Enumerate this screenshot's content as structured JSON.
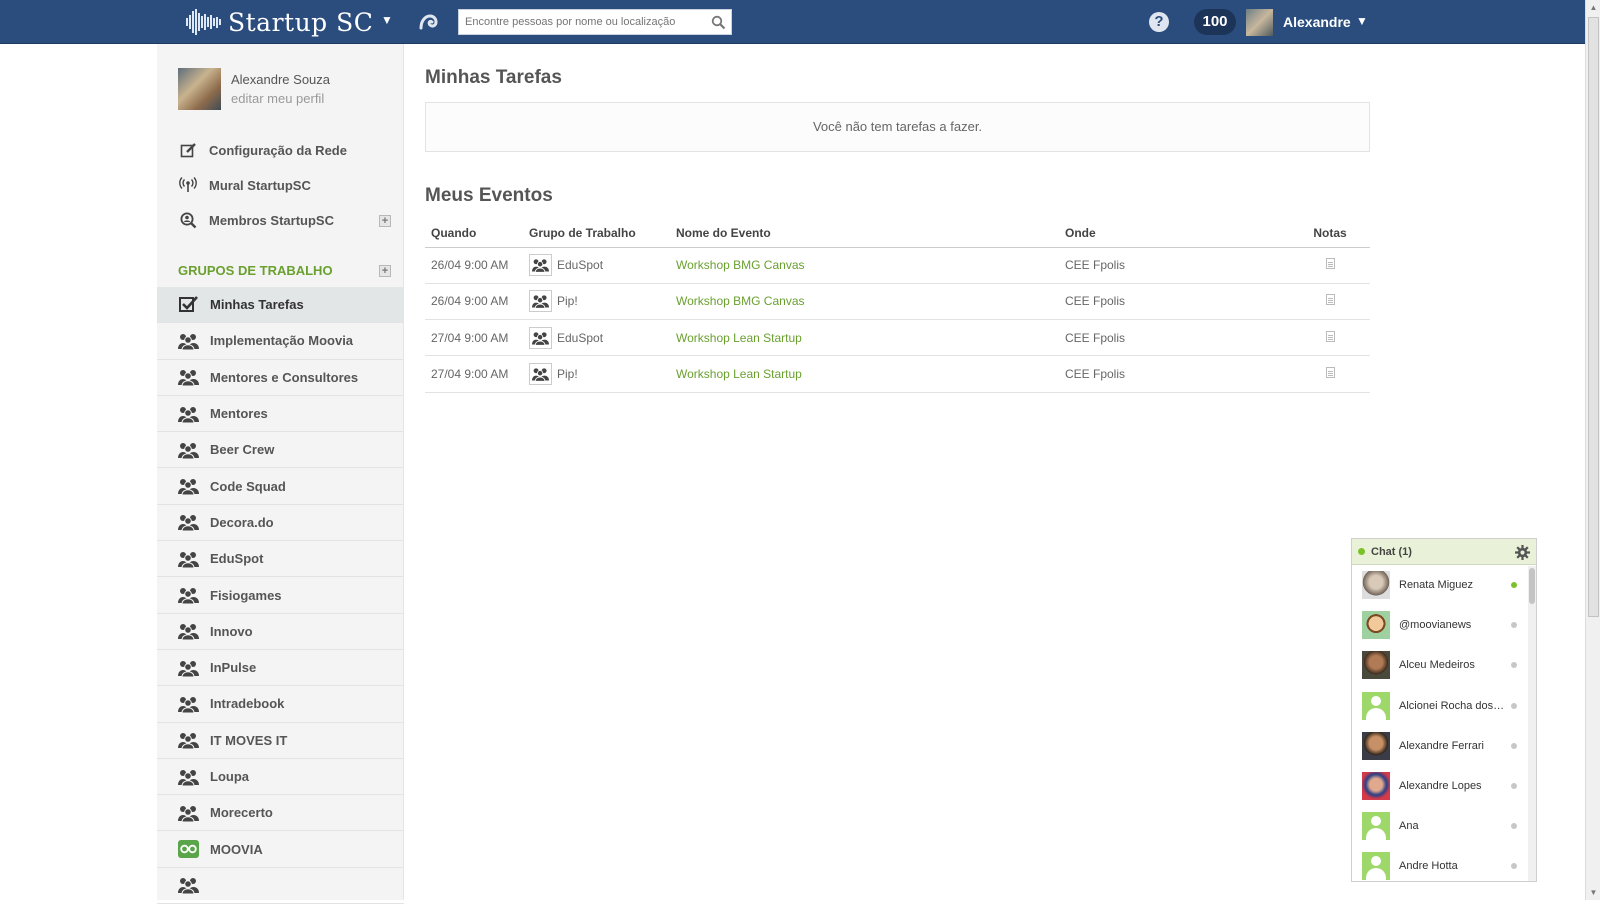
{
  "header": {
    "brand": "Startup SC",
    "search_placeholder": "Encontre pessoas por nome ou localização",
    "points": "100",
    "user_name": "Alexandre"
  },
  "sidebar": {
    "profile_name": "Alexandre Souza",
    "profile_edit": "editar meu perfil",
    "links": [
      {
        "label": "Configuração da Rede",
        "icon": "edit-icon"
      },
      {
        "label": "Mural StartupSC",
        "icon": "broadcast-icon"
      },
      {
        "label": "Membros StartupSC",
        "icon": "members-search-icon"
      }
    ],
    "groups_heading": "GRUPOS DE TRABALHO",
    "groups": [
      {
        "label": "Minhas Tarefas",
        "icon": "checkbox-icon",
        "active": true
      },
      {
        "label": "Implementação Moovia",
        "icon": "group-icon"
      },
      {
        "label": "Mentores e Consultores",
        "icon": "group-icon"
      },
      {
        "label": "Mentores",
        "icon": "group-icon"
      },
      {
        "label": "Beer Crew",
        "icon": "group-icon"
      },
      {
        "label": "Code Squad",
        "icon": "group-icon"
      },
      {
        "label": "Decora.do",
        "icon": "group-icon"
      },
      {
        "label": "EduSpot",
        "icon": "group-icon"
      },
      {
        "label": "Fisiogames",
        "icon": "group-icon"
      },
      {
        "label": "Innovo",
        "icon": "group-icon"
      },
      {
        "label": "InPulse",
        "icon": "group-icon"
      },
      {
        "label": "Intradebook",
        "icon": "group-icon"
      },
      {
        "label": "IT MOVES IT",
        "icon": "group-icon"
      },
      {
        "label": "Loupa",
        "icon": "group-icon"
      },
      {
        "label": "Morecerto",
        "icon": "group-icon"
      },
      {
        "label": "MOOVIA",
        "icon": "moovia-logo-icon"
      },
      {
        "label": "",
        "icon": "group-icon"
      }
    ]
  },
  "main": {
    "tasks_title": "Minhas Tarefas",
    "tasks_empty": "Você não tem tarefas a fazer.",
    "events_title": "Meus Eventos",
    "columns": [
      "Quando",
      "Grupo de Trabalho",
      "Nome do Evento",
      "Onde",
      "Notas"
    ],
    "events": [
      {
        "when": "26/04 9:00 AM",
        "group": "EduSpot",
        "name": "Workshop BMG Canvas",
        "where": "CEE Fpolis"
      },
      {
        "when": "26/04 9:00 AM",
        "group": "Pip!",
        "name": "Workshop BMG Canvas",
        "where": "CEE Fpolis"
      },
      {
        "when": "27/04 9:00 AM",
        "group": "EduSpot",
        "name": "Workshop Lean Startup",
        "where": "CEE Fpolis"
      },
      {
        "when": "27/04 9:00 AM",
        "group": "Pip!",
        "name": "Workshop Lean Startup",
        "where": "CEE Fpolis"
      }
    ]
  },
  "chat": {
    "title": "Chat (1)",
    "contacts": [
      {
        "name": "Renata Miguez",
        "online": true,
        "avatar": "photo"
      },
      {
        "name": "@moovianews",
        "online": false,
        "avatar": "cartoon"
      },
      {
        "name": "Alceu Medeiros",
        "online": false,
        "avatar": "photo"
      },
      {
        "name": "Alcionei Rocha dos Santos",
        "online": false,
        "avatar": "default"
      },
      {
        "name": "Alexandre Ferrari",
        "online": false,
        "avatar": "photo"
      },
      {
        "name": "Alexandre Lopes",
        "online": false,
        "avatar": "photo"
      },
      {
        "name": "Ana",
        "online": false,
        "avatar": "default"
      },
      {
        "name": "Andre Hotta",
        "online": false,
        "avatar": "default"
      }
    ]
  },
  "colors": {
    "header": "#2a4d7e",
    "accent_green": "#6aa02f",
    "online": "#7bc22a"
  }
}
